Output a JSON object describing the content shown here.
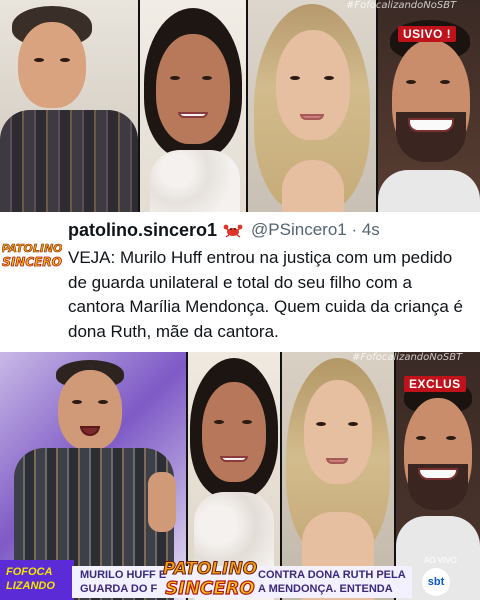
{
  "top_collage": {
    "watermark": "#FofocalizandoNoSBT",
    "badge": "USIVO !"
  },
  "tweet": {
    "logo_line1": "PATOLINO",
    "logo_line2": "SINCERO",
    "display_name": "patolino.sincero1",
    "handle_time": "@PSincero1 · 4s",
    "text": "VEJA: Murilo Huff entrou na justiça com um pedido de guarda unilateral e total do seu filho com a cantora Marília Mendonça. Quem cuida da criança é dona Ruth, mãe da cantora."
  },
  "bottom_collage": {
    "watermark": "#FofocalizandoNoSBT",
    "badge": "EXCLUS",
    "show_logo_line1": "FOFOCA",
    "show_logo_line2": "LIZANDO",
    "lower_third_left_1": "MURILO HUFF E",
    "lower_third_left_2": "GUARDA DO F",
    "lower_third_right_1": "CONTRA DONA RUTH PELA",
    "lower_third_right_2": "A MENDONÇA. ENTENDA",
    "center_logo_line1": "PATOLINO",
    "center_logo_line2": "SINCERO",
    "ao_vivo": "AO VIVO",
    "channel": "sbt"
  },
  "colors": {
    "logo_orange": "#f5a10f",
    "logo_red": "#d31f1f",
    "tweet_text": "#0f1419",
    "handle_gray": "#536471",
    "badge_red": "#c0121a",
    "sbt_blue": "#0a58c9"
  }
}
